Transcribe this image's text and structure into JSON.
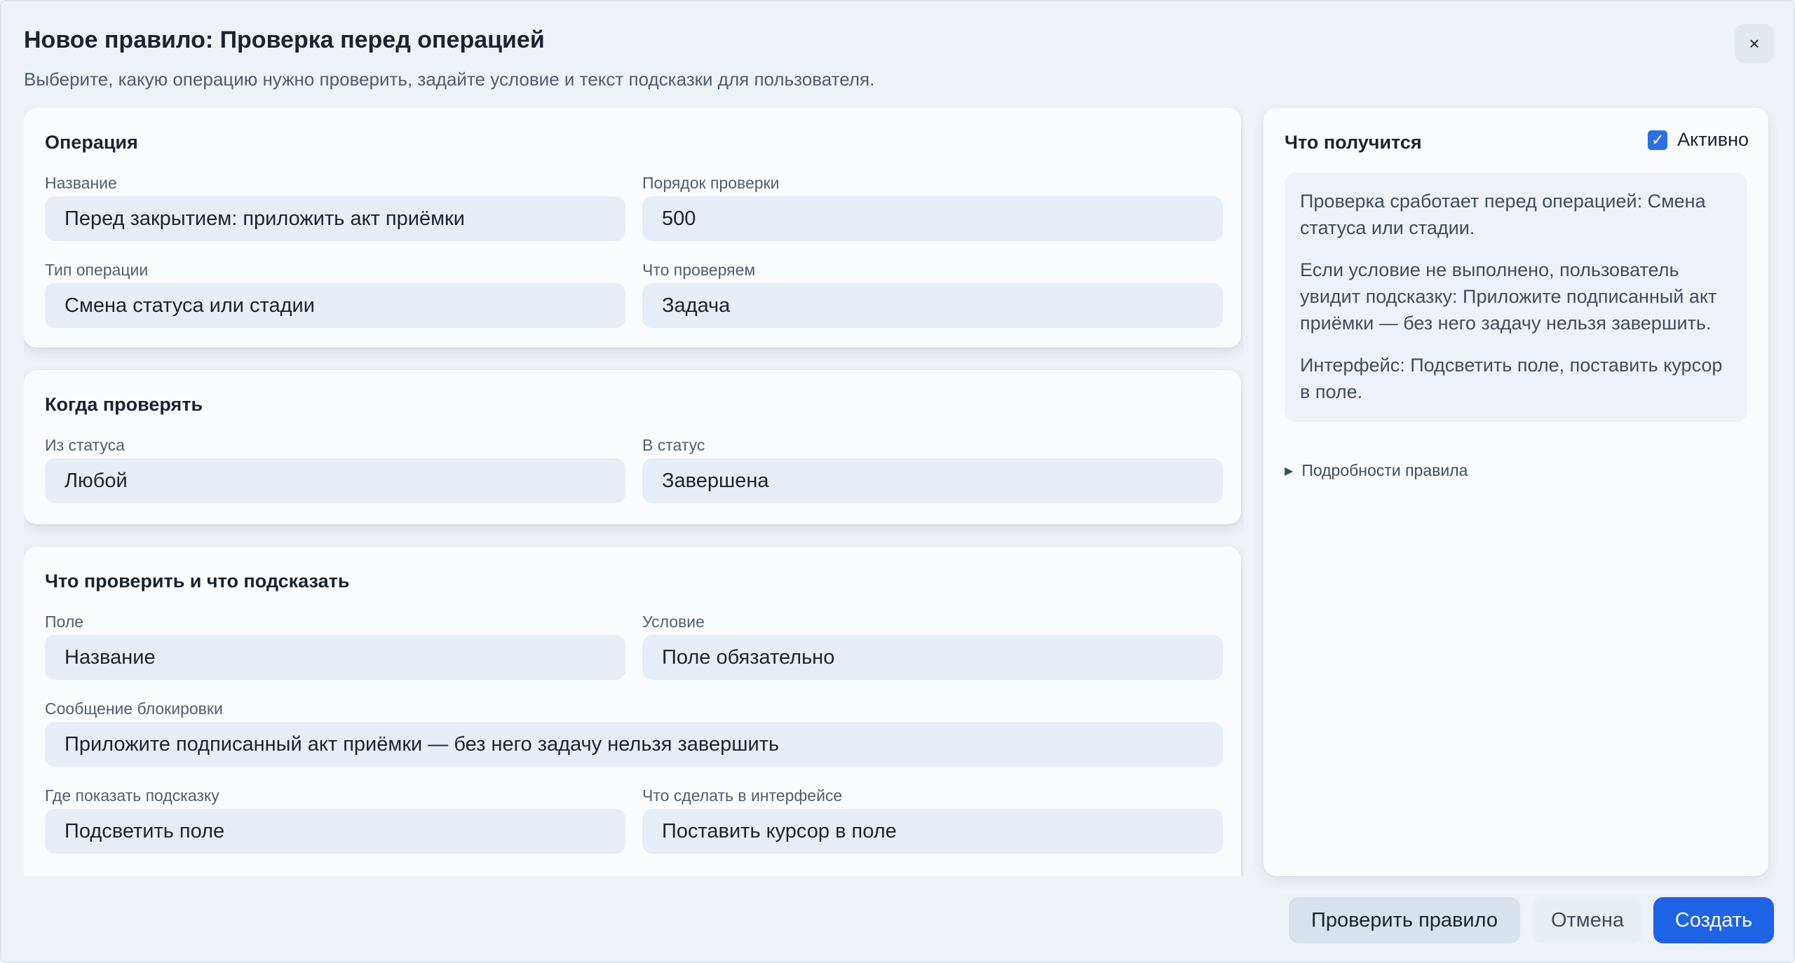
{
  "dialog": {
    "title": "Новое правило: Проверка перед операцией",
    "subtitle": "Выберите, какую операцию нужно проверить, задайте условие и текст подсказки для пользователя.",
    "close_label": "×"
  },
  "operation": {
    "title": "Операция",
    "name_label": "Название",
    "name_value": "Перед закрытием: приложить акт приёмки",
    "order_label": "Порядок проверки",
    "order_value": "500",
    "type_label": "Тип операции",
    "type_value": "Смена статуса или стадии",
    "target_label": "Что проверяем",
    "target_value": "Задача"
  },
  "when": {
    "title": "Когда проверять",
    "from_label": "Из статуса",
    "from_value": "Любой",
    "to_label": "В статус",
    "to_value": "Завершена"
  },
  "check": {
    "title": "Что проверить и что подсказать",
    "field_label": "Поле",
    "field_value": "Название",
    "condition_label": "Условие",
    "condition_value": "Поле обязательно",
    "message_label": "Сообщение блокировки",
    "message_value": "Приложите подписанный акт приёмки — без него задачу нельзя завершить",
    "where_label": "Где показать подсказку",
    "where_value": "Подсветить поле",
    "action_label": "Что сделать в интерфейсе",
    "action_value": "Поставить курсор в поле"
  },
  "summary": {
    "title": "Что получится",
    "active_label": "Активно",
    "active_checked": true,
    "p1": "Проверка сработает перед операцией: Смена статуса или стадии.",
    "p2": "Если условие не выполнено, пользователь увидит подсказку: Приложите подписанный акт приёмки — без него задачу нельзя завершить.",
    "p3": "Интерфейс: Подсветить поле, поставить курсор в поле.",
    "details_label": "Подробности правила"
  },
  "footer": {
    "test_label": "Проверить правило",
    "cancel_label": "Отмена",
    "create_label": "Создать"
  },
  "colors": {
    "accent": "#1f63e6",
    "field_bg": "#e7edf6",
    "checkbox": "#2c6fe0"
  }
}
